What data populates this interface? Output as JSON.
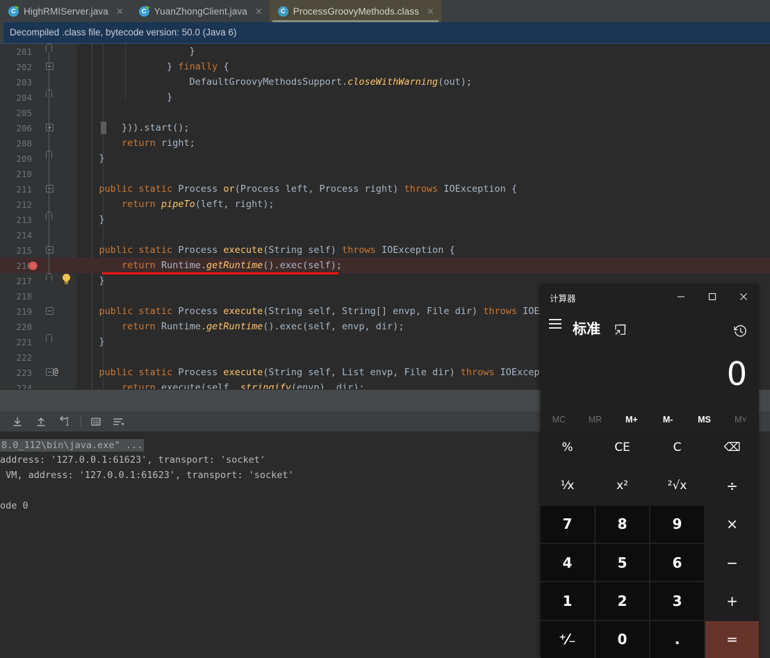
{
  "ide": {
    "tabs": [
      {
        "label": "HighRMIServer.java",
        "icon": "java-file-icon",
        "active": false
      },
      {
        "label": "YuanZhongClient.java",
        "icon": "java-file-icon",
        "active": false
      },
      {
        "label": "ProcessGroovyMethods.class",
        "icon": "class-file-icon",
        "active": true
      }
    ],
    "tab_close_glyph": "✕",
    "notice": "Decompiled .class file, bytecode version: 50.0 (Java 6)",
    "editor": {
      "lines": [
        {
          "num": "201",
          "segments": [
            {
              "t": "                    }",
              "c": "st"
            }
          ]
        },
        {
          "num": "202",
          "segments": [
            {
              "t": "                ",
              "c": "st"
            },
            {
              "t": "} ",
              "c": "st"
            },
            {
              "t": "finally",
              "c": "kw"
            },
            {
              "t": " {",
              "c": "st"
            }
          ]
        },
        {
          "num": "203",
          "segments": [
            {
              "t": "                    DefaultGroovyMethodsSupport.",
              "c": "st"
            },
            {
              "t": "closeWithWarning",
              "c": "mi"
            },
            {
              "t": "(out);",
              "c": "st"
            }
          ]
        },
        {
          "num": "204",
          "segments": [
            {
              "t": "                }",
              "c": "st"
            }
          ]
        },
        {
          "num": "205",
          "segments": []
        },
        {
          "num": "206",
          "segments": [
            {
              "t": "        })).start();",
              "c": "st"
            }
          ]
        },
        {
          "num": "208",
          "segments": [
            {
              "t": "        ",
              "c": "st"
            },
            {
              "t": "return",
              "c": "kw"
            },
            {
              "t": " right;",
              "c": "st"
            }
          ]
        },
        {
          "num": "209",
          "segments": [
            {
              "t": "    }",
              "c": "st"
            }
          ]
        },
        {
          "num": "210",
          "segments": []
        },
        {
          "num": "211",
          "segments": [
            {
              "t": "    ",
              "c": "st"
            },
            {
              "t": "public static",
              "c": "kw"
            },
            {
              "t": " Process ",
              "c": "st"
            },
            {
              "t": "or",
              "c": "me"
            },
            {
              "t": "(Process left, Process right) ",
              "c": "st"
            },
            {
              "t": "throws",
              "c": "kw"
            },
            {
              "t": " IOException {",
              "c": "st"
            }
          ]
        },
        {
          "num": "212",
          "segments": [
            {
              "t": "        ",
              "c": "st"
            },
            {
              "t": "return",
              "c": "kw"
            },
            {
              "t": " ",
              "c": "st"
            },
            {
              "t": "pipeTo",
              "c": "mi"
            },
            {
              "t": "(left, right);",
              "c": "st"
            }
          ]
        },
        {
          "num": "213",
          "segments": [
            {
              "t": "    }",
              "c": "st"
            }
          ]
        },
        {
          "num": "214",
          "segments": []
        },
        {
          "num": "215",
          "segments": [
            {
              "t": "    ",
              "c": "st"
            },
            {
              "t": "public static",
              "c": "kw"
            },
            {
              "t": " Process ",
              "c": "st"
            },
            {
              "t": "execute",
              "c": "me"
            },
            {
              "t": "(String self) ",
              "c": "st"
            },
            {
              "t": "throws",
              "c": "kw"
            },
            {
              "t": " IOException {",
              "c": "st"
            }
          ]
        },
        {
          "num": "216",
          "segments": [
            {
              "t": "        ",
              "c": "st"
            },
            {
              "t": "return",
              "c": "kw"
            },
            {
              "t": " Runtime.",
              "c": "st"
            },
            {
              "t": "getRuntime",
              "c": "mi"
            },
            {
              "t": "().exec(self);",
              "c": "st"
            }
          ]
        },
        {
          "num": "217",
          "segments": [
            {
              "t": "    }",
              "c": "st"
            }
          ]
        },
        {
          "num": "218",
          "segments": []
        },
        {
          "num": "219",
          "segments": [
            {
              "t": "    ",
              "c": "st"
            },
            {
              "t": "public static",
              "c": "kw"
            },
            {
              "t": " Process ",
              "c": "st"
            },
            {
              "t": "execute",
              "c": "me"
            },
            {
              "t": "(String self, String[] envp, File dir) ",
              "c": "st"
            },
            {
              "t": "throws",
              "c": "kw"
            },
            {
              "t": " IOExcept",
              "c": "st"
            }
          ]
        },
        {
          "num": "220",
          "segments": [
            {
              "t": "        ",
              "c": "st"
            },
            {
              "t": "return",
              "c": "kw"
            },
            {
              "t": " Runtime.",
              "c": "st"
            },
            {
              "t": "getRuntime",
              "c": "mi"
            },
            {
              "t": "().exec(self, envp, dir);",
              "c": "st"
            }
          ]
        },
        {
          "num": "221",
          "segments": [
            {
              "t": "    }",
              "c": "st"
            }
          ]
        },
        {
          "num": "222",
          "segments": []
        },
        {
          "num": "223",
          "segments": [
            {
              "t": "    ",
              "c": "st"
            },
            {
              "t": "public static",
              "c": "kw"
            },
            {
              "t": " Process ",
              "c": "st"
            },
            {
              "t": "execute",
              "c": "me"
            },
            {
              "t": "(String self, List envp, File dir) ",
              "c": "st"
            },
            {
              "t": "throws",
              "c": "kw"
            },
            {
              "t": " IOException",
              "c": "st"
            }
          ]
        },
        {
          "num": "224",
          "segments": [
            {
              "t": "        ",
              "c": "st"
            },
            {
              "t": "return",
              "c": "kw"
            },
            {
              "t": " execute(self, ",
              "c": "st"
            },
            {
              "t": "stringify",
              "c": "mi"
            },
            {
              "t": "(envp), dir);",
              "c": "st"
            }
          ]
        }
      ],
      "annotation_marker": "red-underline",
      "breakpoint_line": "216",
      "annotation_at_line": "223"
    },
    "console": {
      "toolbar_icons": [
        "scroll-down-icon",
        "scroll-up-icon",
        "soft-wrap-icon",
        "print-icon",
        "filter-icon"
      ],
      "lines": [
        "8.0_112\\bin\\java.exe\" ...",
        "address: '127.0.0.1:61623', transport: 'socket'",
        " VM, address: '127.0.0.1:61623', transport: 'socket'",
        "ode 0"
      ]
    }
  },
  "calculator": {
    "title": "计算器",
    "window_buttons": [
      {
        "name": "minimize",
        "glyph": "─"
      },
      {
        "name": "maximize",
        "glyph": "□"
      },
      {
        "name": "close",
        "glyph": "✕"
      }
    ],
    "mode": "标准",
    "menu_icon": "hamburger-menu-icon",
    "keep_on_top_icon": "keep-on-top-icon",
    "history_icon": "history-icon",
    "display_value": "0",
    "memory_keys": [
      {
        "label": "MC",
        "disabled": true
      },
      {
        "label": "MR",
        "disabled": true
      },
      {
        "label": "M+",
        "disabled": false
      },
      {
        "label": "M-",
        "disabled": false
      },
      {
        "label": "MS",
        "disabled": false
      },
      {
        "label": "M˅",
        "disabled": true
      }
    ],
    "keys": [
      {
        "label": "%",
        "kind": "fn",
        "name": "percent"
      },
      {
        "label": "CE",
        "kind": "fn",
        "name": "clear-entry"
      },
      {
        "label": "C",
        "kind": "fn",
        "name": "clear"
      },
      {
        "label": "⌫",
        "kind": "fn",
        "name": "backspace"
      },
      {
        "label": "¹⁄x",
        "kind": "fn",
        "name": "reciprocal"
      },
      {
        "label": "x²",
        "kind": "fn",
        "name": "square"
      },
      {
        "label": "²√x",
        "kind": "fn",
        "name": "square-root"
      },
      {
        "label": "÷",
        "kind": "op",
        "name": "divide"
      },
      {
        "label": "7",
        "kind": "num",
        "name": "seven"
      },
      {
        "label": "8",
        "kind": "num",
        "name": "eight"
      },
      {
        "label": "9",
        "kind": "num",
        "name": "nine"
      },
      {
        "label": "×",
        "kind": "op",
        "name": "multiply"
      },
      {
        "label": "4",
        "kind": "num",
        "name": "four"
      },
      {
        "label": "5",
        "kind": "num",
        "name": "five"
      },
      {
        "label": "6",
        "kind": "num",
        "name": "six"
      },
      {
        "label": "−",
        "kind": "op",
        "name": "subtract"
      },
      {
        "label": "1",
        "kind": "num",
        "name": "one"
      },
      {
        "label": "2",
        "kind": "num",
        "name": "two"
      },
      {
        "label": "3",
        "kind": "num",
        "name": "three"
      },
      {
        "label": "+",
        "kind": "op",
        "name": "add"
      },
      {
        "label": "⁺⁄₋",
        "kind": "num",
        "name": "negate"
      },
      {
        "label": "0",
        "kind": "num",
        "name": "zero"
      },
      {
        "label": ".",
        "kind": "num",
        "name": "decimal-point"
      },
      {
        "label": "=",
        "kind": "eq",
        "name": "equals"
      }
    ]
  },
  "colors": {
    "ide_chrome": "#3c3f41",
    "editor_bg": "#2b2b2b",
    "notice_bg": "#1b3654",
    "active_tab": "#4e4b3c",
    "breakpoint": "#db5c5c",
    "annotation_red": "#ff1414",
    "calc_bg": "#202020",
    "calc_equals": "#66342a"
  }
}
